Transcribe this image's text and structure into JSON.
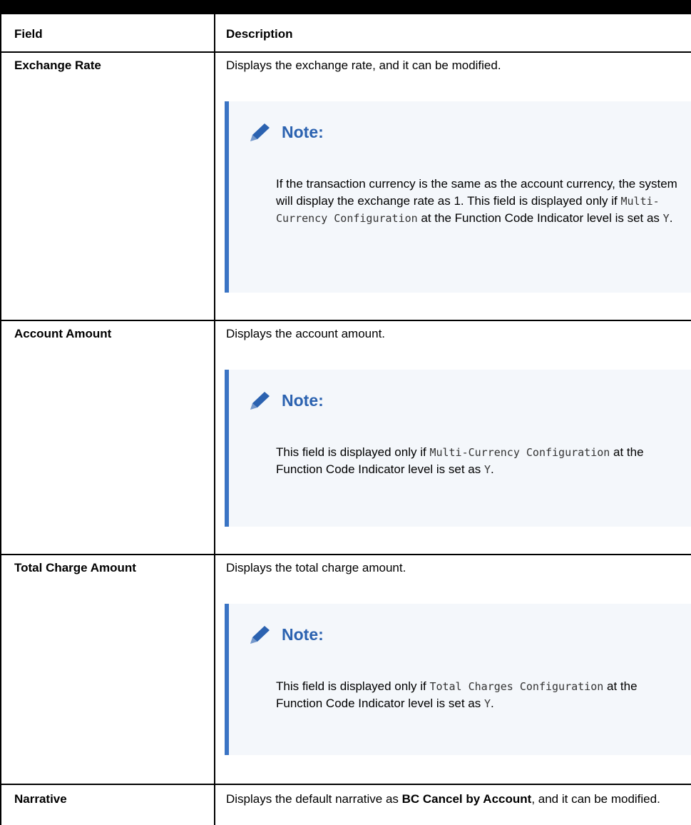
{
  "table": {
    "header": {
      "field": "Field",
      "description": "Description"
    },
    "rows": [
      {
        "field": "Exchange Rate",
        "description": "Displays the exchange rate, and it can be modified.",
        "note": {
          "title": "Note:",
          "parts": [
            "If the transaction currency is the same as the account currency, the system will display the exchange rate as 1. This field is displayed only if ",
            "Multi-Currency Configuration",
            " at the Function Code Indicator level is set as ",
            "Y",
            "."
          ]
        }
      },
      {
        "field": "Account Amount",
        "description": "Displays the account amount.",
        "note": {
          "title": "Note:",
          "parts": [
            "This field is displayed only if ",
            "Multi-Currency Configuration",
            " at the Function Code Indicator level is set as ",
            "Y",
            "."
          ]
        }
      },
      {
        "field": "Total Charge Amount",
        "description": "Displays the total charge amount.",
        "note": {
          "title": "Note:",
          "parts": [
            "This field is displayed only if ",
            "Total Charges Configuration",
            " at the Function Code Indicator level is set as ",
            "Y",
            "."
          ]
        }
      },
      {
        "field": "Narrative",
        "description_parts": [
          "Displays the default narrative as ",
          "BC Cancel by Account",
          ", and it can be modified."
        ]
      }
    ]
  },
  "icons": {
    "note": "pencil-icon"
  },
  "colors": {
    "note_accent": "#3a74c4",
    "note_title": "#2b62b0",
    "note_bg": "#f4f7fb"
  }
}
